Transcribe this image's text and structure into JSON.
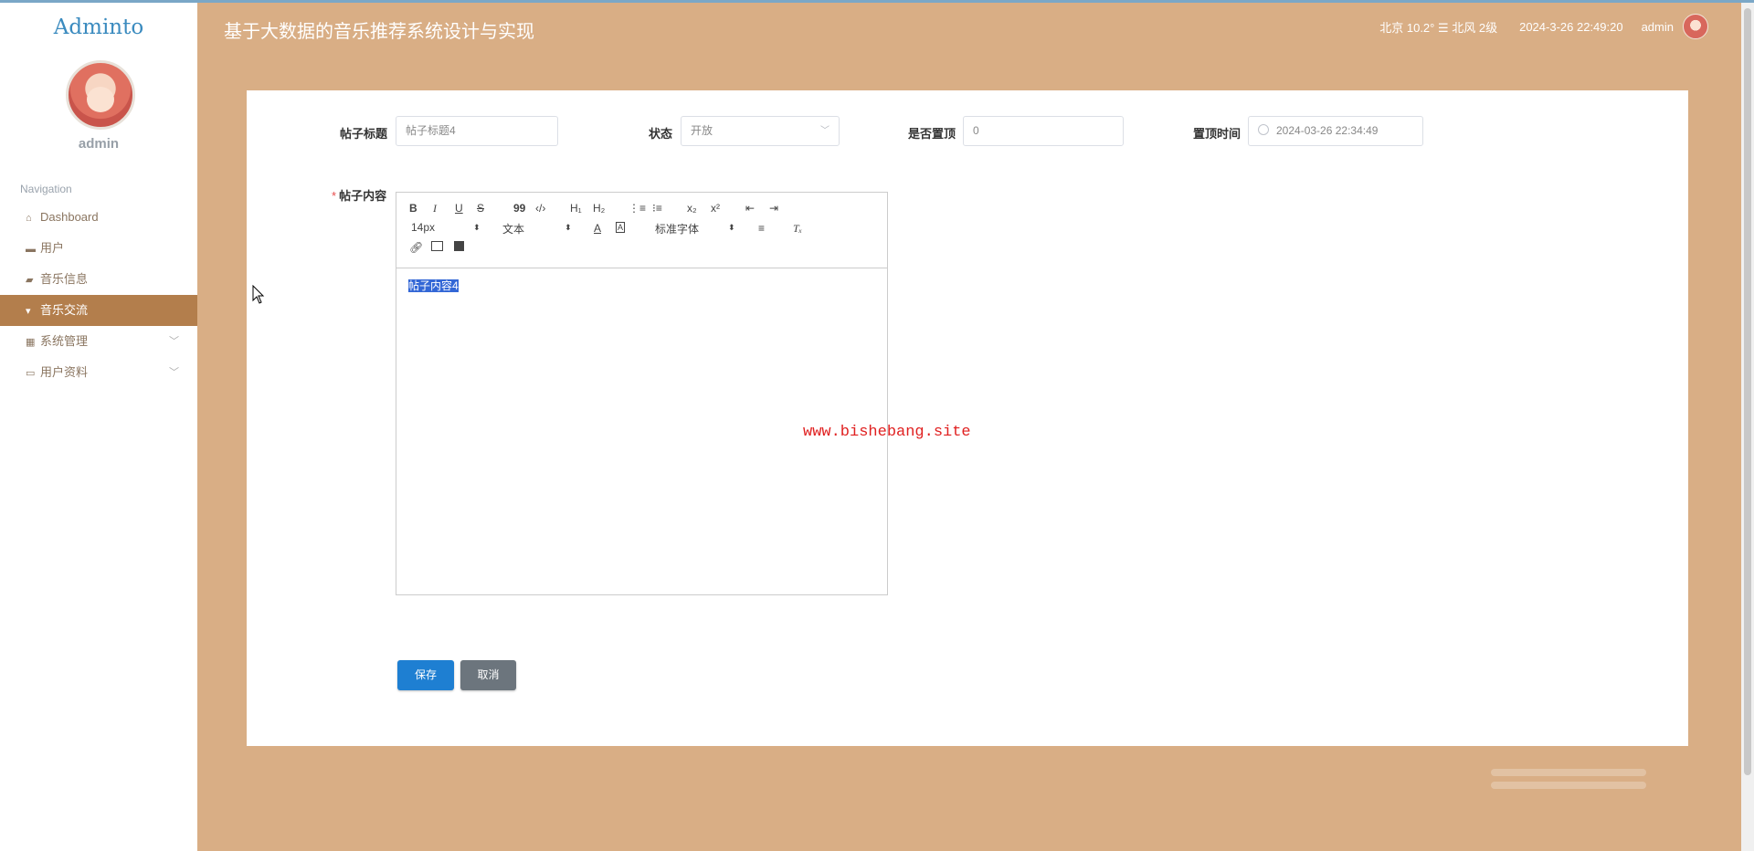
{
  "app": {
    "logo": "Adminto",
    "title": "基于大数据的音乐推荐系统设计与实现"
  },
  "user": {
    "name": "admin"
  },
  "header": {
    "weather": "北京  10.2°  ☰  北风  2级",
    "datetime": "2024-3-26 22:49:20",
    "admin_name": "admin"
  },
  "sidebar": {
    "nav_title": "Navigation",
    "items": [
      {
        "label": "Dashboard",
        "icon": "home-icon"
      },
      {
        "label": "用户",
        "icon": "user-card-icon"
      },
      {
        "label": "音乐信息",
        "icon": "music-info-icon"
      },
      {
        "label": "音乐交流",
        "icon": "chat-icon",
        "active": true
      },
      {
        "label": "系统管理",
        "icon": "grid-icon",
        "expandable": true
      },
      {
        "label": "用户资料",
        "icon": "profile-icon",
        "expandable": true
      }
    ]
  },
  "form": {
    "title_label": "帖子标题",
    "title_value": "帖子标题4",
    "status_label": "状态",
    "status_value": "开放",
    "top_label": "是否置顶",
    "top_value": "0",
    "top_time_label": "置顶时间",
    "top_time_value": "2024-03-26 22:34:49",
    "content_label": "帖子内容",
    "required_mark": "*",
    "content_value": "帖子内容4"
  },
  "editor_toolbar": {
    "bold": "B",
    "italic": "I",
    "underline": "U",
    "strike": "S",
    "blockquote": "99",
    "code": "‹/›",
    "h1": "H₁",
    "h2": "H₂",
    "ordered_list": "⋮≡",
    "bullet_list": "⁝≡",
    "subscript": "x₂",
    "superscript": "x²",
    "outdent": "⇤",
    "indent": "⇥",
    "size_select": "14px",
    "header_select": "文本",
    "font_select": "标准字体",
    "color": "A",
    "background": "A",
    "align": "≡",
    "clean": "Tₓ"
  },
  "buttons": {
    "save": "保存",
    "cancel": "取消"
  },
  "watermark": "www.bishebang.site",
  "colors": {
    "background": "#d9ae85",
    "active_nav": "#b37e4c",
    "save_button": "#1e7fd2",
    "cancel_button": "#6c757d",
    "watermark": "#e02020",
    "logo": "#3b8bbf"
  }
}
